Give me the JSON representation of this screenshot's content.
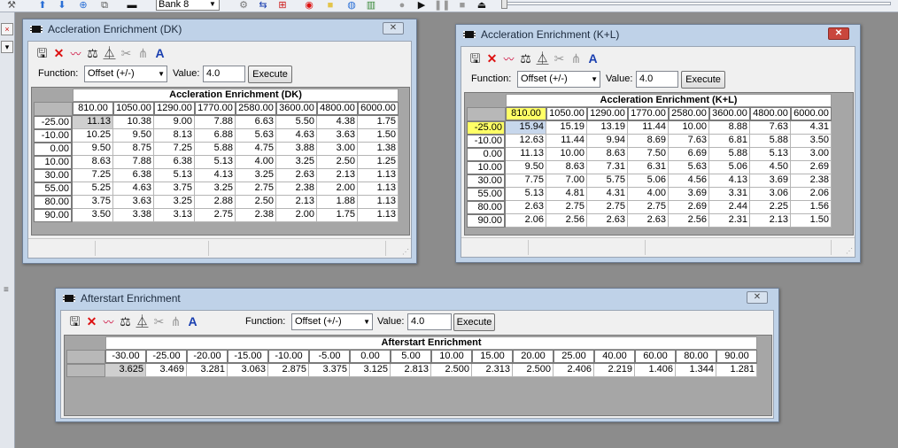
{
  "toolbar": {
    "bank_value": "Bank 8",
    "icons": [
      "wrench-icon",
      "arrow-up-icon",
      "arrow-down-icon",
      "download-icon",
      "copy-icon",
      "chip-icon",
      "gears-icon",
      "swap-arrows-icon",
      "tree-icon",
      "target-icon",
      "folder-icon",
      "globe-icon",
      "bar-chart-icon",
      "record-icon",
      "play-icon",
      "pause-icon",
      "stop-icon",
      "eject-icon"
    ]
  },
  "leftdock": {
    "close_glyph": "×",
    "down_glyph": "▾",
    "grip": "≡"
  },
  "common": {
    "function_label": "Function:",
    "function_value": "Offset (+/-)",
    "value_label": "Value:",
    "value_value": "4.0",
    "execute_label": "Execute",
    "close_glyph": "✕"
  },
  "colors": {
    "highlight": "#ffff66",
    "selection": "#c7d7ec",
    "close_active": "#c9463d"
  },
  "windows": {
    "dk": {
      "title": "Accleration Enrichment (DK)",
      "grid_title": "Accleration Enrichment (DK)",
      "cols": [
        "810.00",
        "1050.00",
        "1290.00",
        "1770.00",
        "2580.00",
        "3600.00",
        "4800.00",
        "6000.00"
      ],
      "rows": [
        "-25.00",
        "-10.00",
        "0.00",
        "10.00",
        "30.00",
        "55.00",
        "80.00",
        "90.00"
      ],
      "values": [
        [
          "11.13",
          "10.38",
          "9.00",
          "7.88",
          "6.63",
          "5.50",
          "4.38",
          "1.75"
        ],
        [
          "10.25",
          "9.50",
          "8.13",
          "6.88",
          "5.63",
          "4.63",
          "3.63",
          "1.50"
        ],
        [
          "9.50",
          "8.75",
          "7.25",
          "5.88",
          "4.75",
          "3.88",
          "3.00",
          "1.38"
        ],
        [
          "8.63",
          "7.88",
          "6.38",
          "5.13",
          "4.00",
          "3.25",
          "2.50",
          "1.25"
        ],
        [
          "7.25",
          "6.38",
          "5.13",
          "4.13",
          "3.25",
          "2.63",
          "2.13",
          "1.13"
        ],
        [
          "5.25",
          "4.63",
          "3.75",
          "3.25",
          "2.75",
          "2.38",
          "2.00",
          "1.13"
        ],
        [
          "3.75",
          "3.63",
          "3.25",
          "2.88",
          "2.50",
          "2.13",
          "1.88",
          "1.13"
        ],
        [
          "3.50",
          "3.38",
          "3.13",
          "2.75",
          "2.38",
          "2.00",
          "1.75",
          "1.13"
        ]
      ]
    },
    "kl": {
      "title": "Accleration Enrichment (K+L)",
      "grid_title": "Accleration Enrichment (K+L)",
      "cols": [
        "810.00",
        "1050.00",
        "1290.00",
        "1770.00",
        "2580.00",
        "3600.00",
        "4800.00",
        "6000.00"
      ],
      "rows": [
        "-25.00",
        "-10.00",
        "0.00",
        "10.00",
        "30.00",
        "55.00",
        "80.00",
        "90.00"
      ],
      "values": [
        [
          "15.94",
          "15.19",
          "13.19",
          "11.44",
          "10.00",
          "8.88",
          "7.63",
          "4.31"
        ],
        [
          "12.63",
          "11.44",
          "9.94",
          "8.69",
          "7.63",
          "6.81",
          "5.88",
          "3.50"
        ],
        [
          "11.13",
          "10.00",
          "8.63",
          "7.50",
          "6.69",
          "5.88",
          "5.13",
          "3.00"
        ],
        [
          "9.50",
          "8.63",
          "7.31",
          "6.31",
          "5.63",
          "5.06",
          "4.50",
          "2.69"
        ],
        [
          "7.75",
          "7.00",
          "5.75",
          "5.06",
          "4.56",
          "4.13",
          "3.69",
          "2.38"
        ],
        [
          "5.13",
          "4.81",
          "4.31",
          "4.00",
          "3.69",
          "3.31",
          "3.06",
          "2.06"
        ],
        [
          "2.63",
          "2.75",
          "2.75",
          "2.75",
          "2.69",
          "2.44",
          "2.25",
          "1.56"
        ],
        [
          "2.06",
          "2.56",
          "2.63",
          "2.63",
          "2.56",
          "2.31",
          "2.13",
          "1.50"
        ]
      ]
    },
    "as": {
      "title": "Afterstart Enrichment",
      "grid_title": "Afterstart Enrichment",
      "cols": [
        "-30.00",
        "-25.00",
        "-20.00",
        "-15.00",
        "-10.00",
        "-5.00",
        "0.00",
        "5.00",
        "10.00",
        "15.00",
        "20.00",
        "25.00",
        "40.00",
        "60.00",
        "80.00",
        "90.00"
      ],
      "values": [
        "3.625",
        "3.469",
        "3.281",
        "3.063",
        "2.875",
        "3.375",
        "3.125",
        "2.813",
        "2.500",
        "2.313",
        "2.500",
        "2.406",
        "2.219",
        "1.406",
        "1.344",
        "1.281"
      ]
    }
  }
}
